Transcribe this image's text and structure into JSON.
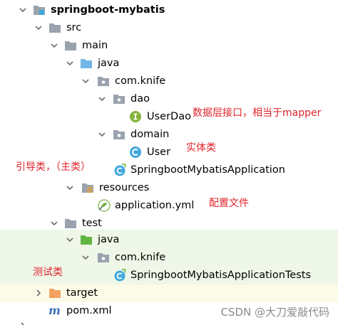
{
  "tree": {
    "project": "springboot-mybatis",
    "src": "src",
    "main": "main",
    "java_main": "java",
    "pkg_main": "com.knife",
    "dao": "dao",
    "user_dao": "UserDao",
    "domain": "domain",
    "user": "User",
    "app_class": "SpringbootMybatisApplication",
    "resources": "resources",
    "app_yml": "application.yml",
    "test": "test",
    "java_test": "java",
    "pkg_test": "com.knife",
    "test_class": "SpringbootMybatisApplicationTests",
    "target": "target",
    "pom": "pom.xml"
  },
  "annotations": {
    "dao_note": "数据层接口，相当于mapper",
    "entity_note": "实体类",
    "boot_note": "引导类，（主类）",
    "config_note": "配置文件",
    "test_note": "测试类"
  },
  "watermark": "CSDN @大刀爱敲代码",
  "colors": {
    "folder": "#9aa3ad",
    "source_folder": "#73b7e6",
    "test_folder": "#62b543",
    "target_folder": "#f4a261",
    "interface_icon": "#85b33b",
    "class_icon": "#40a8dd",
    "annotation": "#e0242b",
    "test_row_bg": "#eef7e8"
  },
  "icons": {
    "folder": "folder-icon",
    "package": "package-icon",
    "interface": "interface-icon",
    "class": "class-icon",
    "yaml": "spring-config-icon",
    "maven": "maven-icon"
  }
}
